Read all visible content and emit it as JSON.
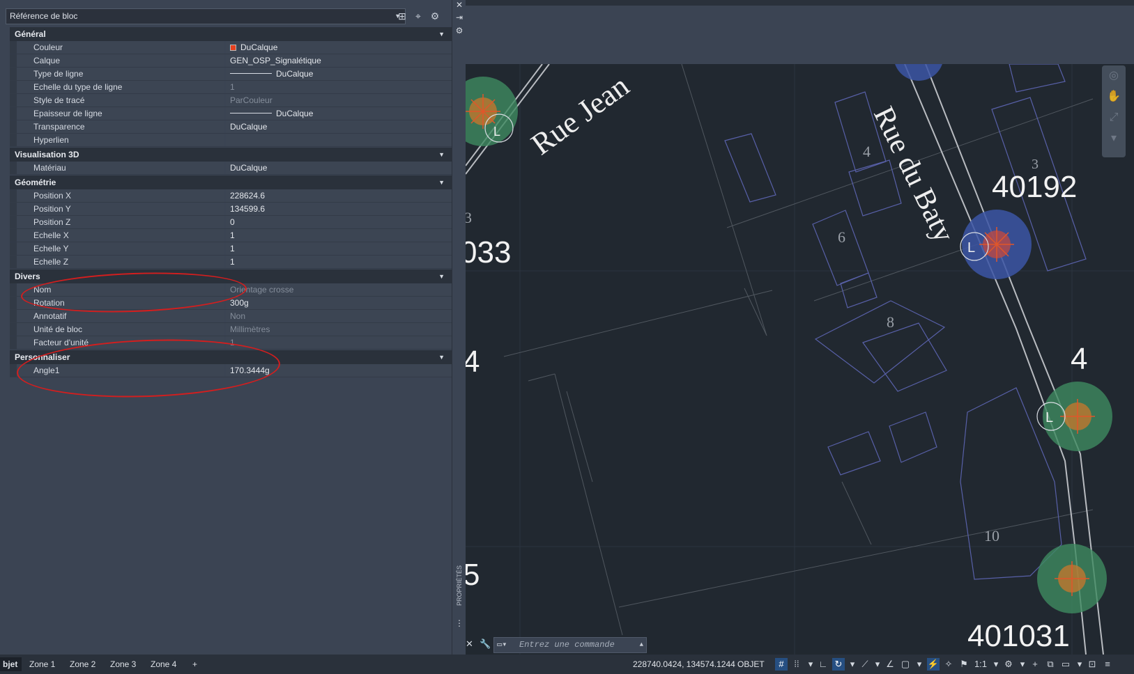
{
  "palette": {
    "selector_value": "Référence de bloc",
    "title_vertical": "PROPRIÉTÉS",
    "categories": [
      {
        "name": "Général",
        "rows": [
          {
            "label": "Couleur",
            "value": "DuCalque",
            "decor": "swatch",
            "dim": false
          },
          {
            "label": "Calque",
            "value": "GEN_OSP_Signalétique",
            "dim": false
          },
          {
            "label": "Type de ligne",
            "value": "DuCalque",
            "decor": "line",
            "dim": false
          },
          {
            "label": "Echelle du type de ligne",
            "value": "1",
            "dim": true
          },
          {
            "label": "Style de tracé",
            "value": "ParCouleur",
            "dim": true
          },
          {
            "label": "Epaisseur de ligne",
            "value": "DuCalque",
            "decor": "line",
            "dim": false
          },
          {
            "label": "Transparence",
            "value": "DuCalque",
            "dim": false
          },
          {
            "label": "Hyperlien",
            "value": "",
            "dim": false
          }
        ]
      },
      {
        "name": "Visualisation 3D",
        "rows": [
          {
            "label": "Matériau",
            "value": "DuCalque",
            "dim": false
          }
        ]
      },
      {
        "name": "Géométrie",
        "rows": [
          {
            "label": "Position X",
            "value": "228624.6",
            "dim": false
          },
          {
            "label": "Position Y",
            "value": "134599.6",
            "dim": false
          },
          {
            "label": "Position Z",
            "value": "0",
            "dim": false
          },
          {
            "label": "Echelle X",
            "value": "1",
            "dim": false
          },
          {
            "label": "Echelle Y",
            "value": "1",
            "dim": false
          },
          {
            "label": "Echelle Z",
            "value": "1",
            "dim": false
          }
        ]
      },
      {
        "name": "Divers",
        "rows": [
          {
            "label": "Nom",
            "value": "Orientage crosse",
            "dim": true
          },
          {
            "label": "Rotation",
            "value": "300g",
            "dim": false
          },
          {
            "label": "Annotatif",
            "value": "Non",
            "dim": true
          },
          {
            "label": "Unité de bloc",
            "value": "Millimètres",
            "dim": true
          },
          {
            "label": "Facteur d'unité",
            "value": "1",
            "dim": true
          }
        ]
      },
      {
        "name": "Personnaliser",
        "rows": [
          {
            "label": "Angle1",
            "value": "170.3444g",
            "dim": false
          }
        ]
      }
    ]
  },
  "drawing": {
    "street_labels": [
      "Rue Jean",
      "Rue du Baty"
    ],
    "big_numbers": [
      "40192",
      "033",
      "4",
      "4",
      "5",
      "401031"
    ],
    "house_numbers": [
      "3",
      "4",
      "6",
      "8",
      "10",
      "3"
    ],
    "marker_letter": "L"
  },
  "command_line": {
    "placeholder": "Entrez une commande"
  },
  "layout_tabs": [
    "bjet",
    "Zone 1",
    "Zone 2",
    "Zone 3",
    "Zone 4",
    "+"
  ],
  "status_bar": {
    "coordinates": "228740.0424, 134574.1244",
    "mode": "OBJET",
    "scale": "1:1"
  },
  "colors": {
    "annotation_red": "#d41e1e",
    "marker_green": "#3f8a60",
    "marker_blue": "#3b55a4",
    "building_outline": "#5860a8"
  }
}
